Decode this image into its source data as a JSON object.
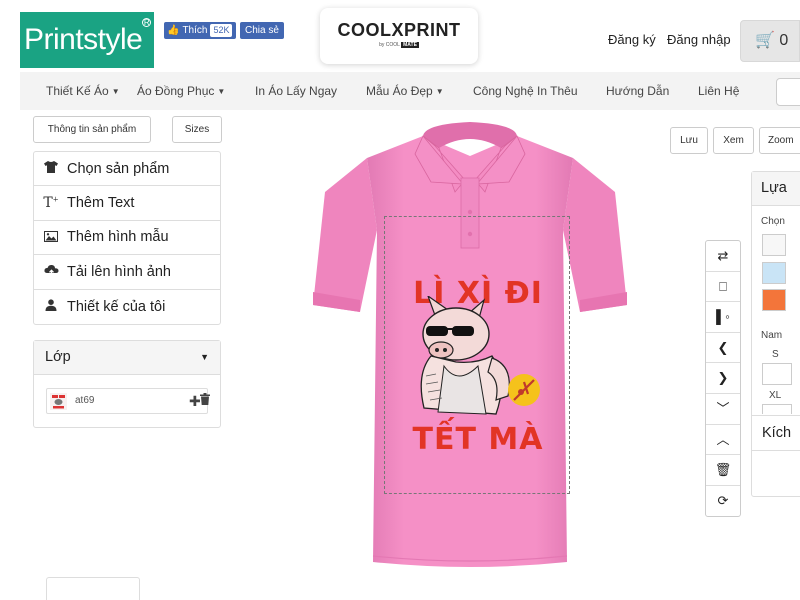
{
  "header": {
    "logo_text": "Printstyle",
    "logo_reg": "R",
    "fb_like_label": "Thích",
    "fb_like_count": "52K",
    "fb_share_label": "Chia sẻ",
    "partner_logo": "COOLXPRINT",
    "partner_sub": "by COOL",
    "partner_sub_badge": "MATE",
    "register": "Đăng ký",
    "login": "Đăng nhập",
    "cart_count": "0"
  },
  "nav": {
    "items": [
      {
        "label": "Thiết Kế Áo",
        "dropdown": true
      },
      {
        "label": "Áo Đồng Phục",
        "dropdown": true
      },
      {
        "label": "In Áo Lấy Ngay",
        "dropdown": false
      },
      {
        "label": "Mẫu Áo Đẹp",
        "dropdown": true
      },
      {
        "label": "Công Nghệ In Thêu",
        "dropdown": false
      },
      {
        "label": "Hướng Dẫn",
        "dropdown": false
      },
      {
        "label": "Liên Hệ",
        "dropdown": false
      }
    ]
  },
  "product": {
    "info_button": "Thông tin sản phẩm",
    "sizes_button": "Sizes"
  },
  "top_actions": {
    "save": "Lưu",
    "view": "Xem",
    "zoom": "Zoom"
  },
  "menu": {
    "items": [
      {
        "label": "Chọn sản phẩm",
        "icon": "tshirt-icon"
      },
      {
        "label": "Thêm Text",
        "icon": "text-add-icon"
      },
      {
        "label": "Thêm hình mẫu",
        "icon": "image-icon"
      },
      {
        "label": "Tải lên hình ảnh",
        "icon": "cloud-upload-icon"
      },
      {
        "label": "Thiết kế của tôi",
        "icon": "user-icon"
      }
    ]
  },
  "layers": {
    "title": "Lớp",
    "item_name": "at69"
  },
  "design": {
    "shirt_color": "#f590c6",
    "line1": "LÌ XÌ ĐI",
    "line2": "TẾT MÀ",
    "text_color": "#e23425"
  },
  "right_panel": {
    "title": "Lựa",
    "color_label": "Chọn",
    "swatches": [
      "#f7f7f7",
      "#c9e4f6",
      "#f3753a"
    ],
    "gender_label": "Nam",
    "size_s": "S",
    "size_xl": "XL",
    "size_section": "Kích"
  }
}
